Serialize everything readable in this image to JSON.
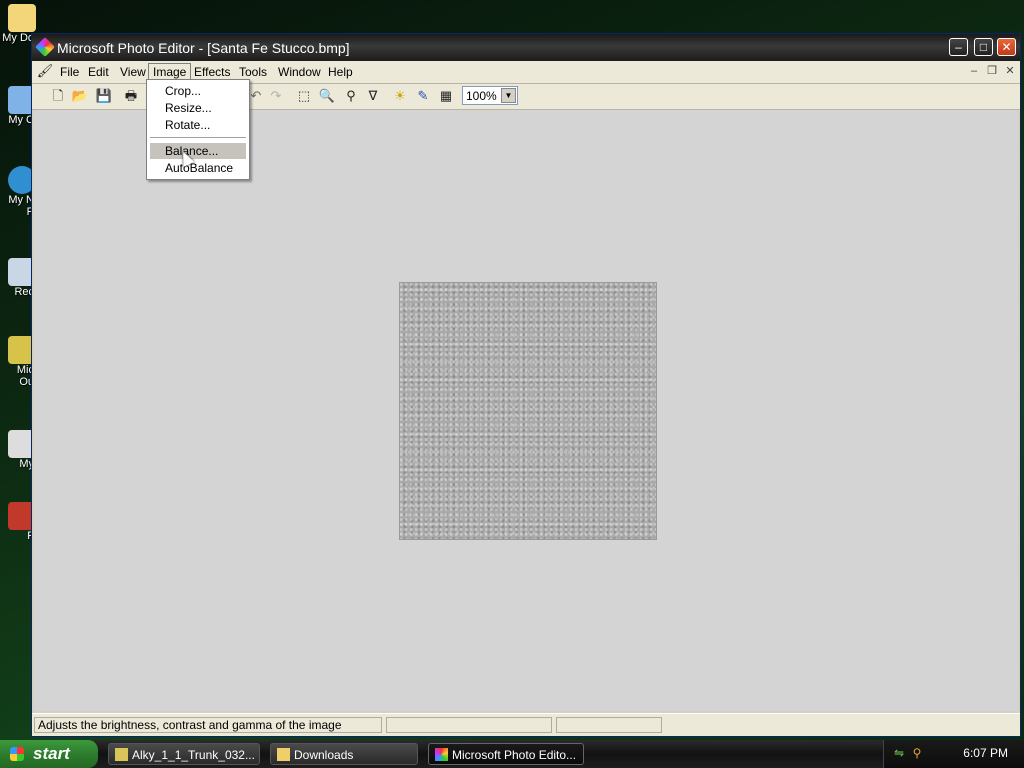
{
  "desktop": {
    "icons": [
      "My Do",
      "My C",
      "My N\nP",
      "Rec",
      "Mic\nOu",
      "My",
      "F"
    ]
  },
  "window": {
    "title": "Microsoft Photo Editor - [Santa Fe Stucco.bmp]",
    "controls": {
      "minimize": "–",
      "maximize": "□",
      "close": "✕"
    }
  },
  "menubar": {
    "items": [
      "File",
      "Edit",
      "View",
      "Image",
      "Effects",
      "Tools",
      "Window",
      "Help"
    ],
    "active": "Image",
    "mdi": {
      "minimize": "–",
      "restore": "❐",
      "close": "✕"
    }
  },
  "toolbar": {
    "zoom": "100%",
    "zoom_arrow": "▼",
    "tools": [
      {
        "name": "new-icon",
        "glyph": "🗋"
      },
      {
        "name": "open-icon",
        "glyph": "📂"
      },
      {
        "name": "save-icon",
        "glyph": "💾"
      },
      {
        "name": "print-icon",
        "glyph": "🖶"
      },
      {
        "name": "undo-icon",
        "glyph": "↶"
      },
      {
        "name": "redo-icon",
        "glyph": "↷"
      },
      {
        "name": "select-icon",
        "glyph": "⬚"
      },
      {
        "name": "zoom-icon",
        "glyph": "🔍"
      },
      {
        "name": "pointer-tool-icon",
        "glyph": "⚲"
      },
      {
        "name": "filter-tool-icon",
        "glyph": "∇"
      },
      {
        "name": "brightness-icon",
        "glyph": "☀"
      },
      {
        "name": "pen-icon",
        "glyph": "✎"
      },
      {
        "name": "pattern-icon",
        "glyph": "▦"
      }
    ]
  },
  "image_menu": {
    "items": [
      "Crop...",
      "Resize...",
      "Rotate...",
      "Balance...",
      "AutoBalance"
    ],
    "highlighted": "Balance..."
  },
  "statusbar": {
    "message": "Adjusts the brightness, contrast and gamma of the image",
    "pane2": "",
    "pane3": ""
  },
  "taskbar": {
    "start": "start",
    "tasks": [
      "Alky_1_1_Trunk_032...",
      "Downloads",
      "Microsoft Photo Edito..."
    ],
    "clock": "6:07 PM"
  }
}
